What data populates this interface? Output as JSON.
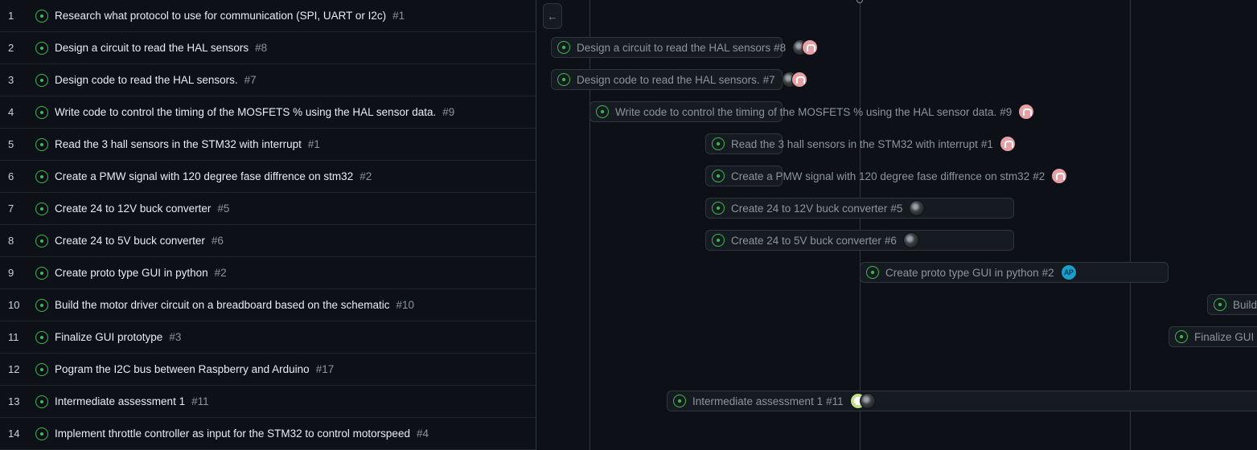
{
  "rows": [
    {
      "num": "1",
      "title": "Research what protocol to use for communication (SPI, UART or I2c)",
      "issue": "#1"
    },
    {
      "num": "2",
      "title": "Design a circuit to read the HAL sensors",
      "issue": "#8"
    },
    {
      "num": "3",
      "title": "Design code to read the HAL sensors.",
      "issue": "#7"
    },
    {
      "num": "4",
      "title": "Write code to control the timing of the MOSFETS % using the HAL sensor data.",
      "issue": "#9"
    },
    {
      "num": "5",
      "title": "Read the 3 hall sensors in the STM32 with interrupt",
      "issue": "#1"
    },
    {
      "num": "6",
      "title": "Create a PMW signal with 120 degree fase diffrence on stm32",
      "issue": "#2"
    },
    {
      "num": "7",
      "title": "Create 24 to 12V buck converter",
      "issue": "#5"
    },
    {
      "num": "8",
      "title": "Create 24 to 5V buck converter",
      "issue": "#6"
    },
    {
      "num": "9",
      "title": "Create proto type GUI in python",
      "issue": "#2"
    },
    {
      "num": "10",
      "title": "Build the motor driver circuit on a breadboard based on the schematic",
      "issue": "#10"
    },
    {
      "num": "11",
      "title": "Finalize GUI prototype",
      "issue": "#3"
    },
    {
      "num": "12",
      "title": "Pogram the I2C bus between Raspberry and Arduino",
      "issue": "#17"
    },
    {
      "num": "13",
      "title": "Intermediate assessment 1",
      "issue": "#11"
    },
    {
      "num": "14",
      "title": "Implement throttle controller as input for the STM32 to control motorspeed",
      "issue": "#4"
    }
  ],
  "timeline": {
    "collapse_icon": "arrow-left-icon",
    "bars": [
      {
        "row": 2,
        "title": "Design a circuit to read the HAL sensors",
        "issue": "#8",
        "avatars": [
          "dark",
          "pink"
        ]
      },
      {
        "row": 3,
        "title": "Design code to read the HAL sensors.",
        "issue": "#7",
        "avatars": [
          "dark",
          "pink"
        ]
      },
      {
        "row": 4,
        "title": "Write code to control the timing of the MOSFETS % using the HAL sensor data.",
        "issue": "#9",
        "avatars": [
          "pink"
        ]
      },
      {
        "row": 5,
        "title": "Read the 3 hall sensors in the STM32 with interrupt",
        "issue": "#1",
        "avatars": [
          "pink"
        ]
      },
      {
        "row": 6,
        "title": "Create a PMW signal with 120 degree fase diffrence on stm32",
        "issue": "#2",
        "avatars": [
          "pink"
        ]
      },
      {
        "row": 7,
        "title": "Create 24 to 12V buck converter",
        "issue": "#5",
        "avatars": [
          "dark"
        ]
      },
      {
        "row": 8,
        "title": "Create 24 to 5V buck converter",
        "issue": "#6",
        "avatars": [
          "dark"
        ]
      },
      {
        "row": 9,
        "title": "Create proto type GUI in python",
        "issue": "#2",
        "avatars": [
          "teal"
        ]
      },
      {
        "row": 10,
        "title": "Build",
        "issue": "",
        "avatars": []
      },
      {
        "row": 11,
        "title": "Finalize GUI",
        "issue": "",
        "avatars": []
      },
      {
        "row": 13,
        "title": "Intermediate assessment 1",
        "issue": "#11",
        "avatars": [
          "green",
          "dark"
        ]
      }
    ],
    "teal_avatar_text": "AP"
  },
  "colors": {
    "background": "#0d1117",
    "border": "#30363d",
    "open_status": "#3fb950",
    "muted_text": "#8b949e"
  }
}
